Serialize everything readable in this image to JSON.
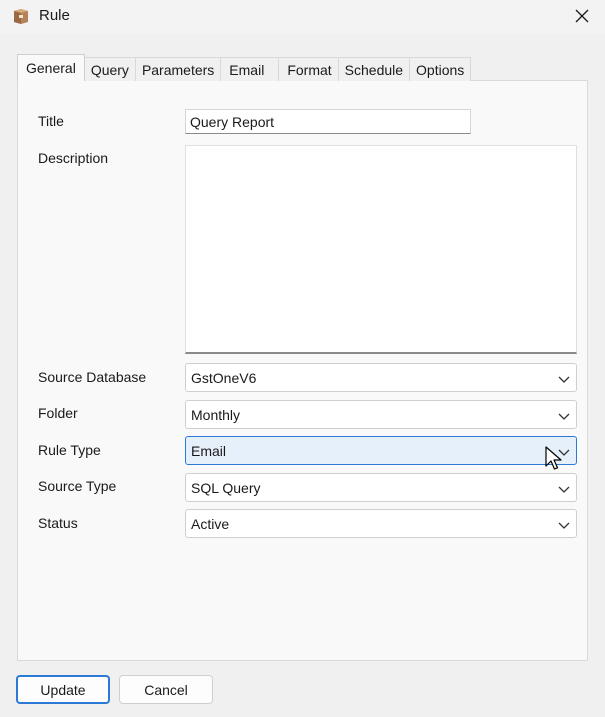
{
  "window": {
    "title": "Rule",
    "app_icon": "box-icon",
    "close_icon": "close-icon"
  },
  "tabs": [
    {
      "label": "General",
      "active": true
    },
    {
      "label": "Query",
      "active": false
    },
    {
      "label": "Parameters",
      "active": false
    },
    {
      "label": "Email",
      "active": false
    },
    {
      "label": "Format",
      "active": false
    },
    {
      "label": "Schedule",
      "active": false
    },
    {
      "label": "Options",
      "active": false
    }
  ],
  "form": {
    "title_label": "Title",
    "title_value": "Query Report",
    "description_label": "Description",
    "description_value": "",
    "source_database_label": "Source Database",
    "source_database_value": "GstOneV6",
    "folder_label": "Folder",
    "folder_value": "Monthly",
    "rule_type_label": "Rule Type",
    "rule_type_value": "Email",
    "source_type_label": "Source Type",
    "source_type_value": "SQL Query",
    "status_label": "Status",
    "status_value": "Active"
  },
  "buttons": {
    "update_label": "Update",
    "cancel_label": "Cancel"
  },
  "colors": {
    "accent": "#2b7bd6",
    "hover_fill": "#e6f0fa"
  }
}
